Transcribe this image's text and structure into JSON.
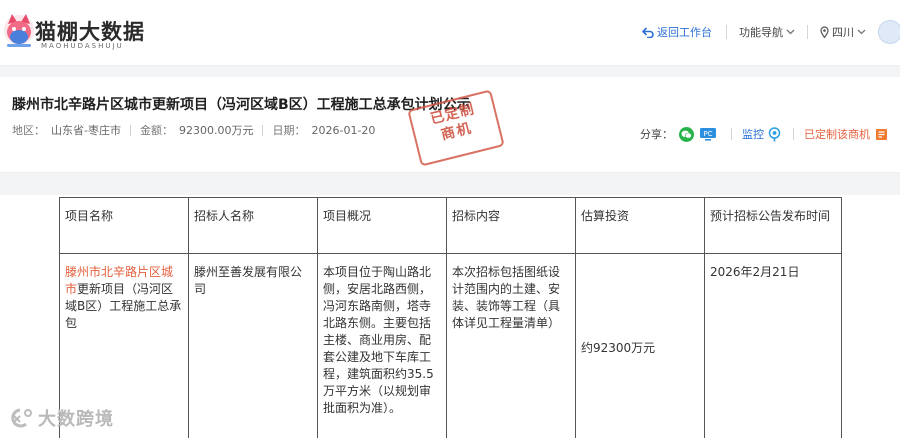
{
  "header": {
    "logo_title": "猫棚大数据",
    "logo_sub": "MAOHUDASHUJU",
    "return_label": "返回工作台",
    "nav_label": "功能导航",
    "region_label": "四川"
  },
  "project": {
    "title": "滕州市北辛路片区城市更新项目（冯河区域B区）工程施工总承包计划公示",
    "region_label": "地区：",
    "region_value": "山东省-枣庄市",
    "amount_label": "金额：",
    "amount_value": "92300.00万元",
    "date_label": "日期：",
    "date_value": "2026-01-20",
    "stamp_line1": "已定制",
    "stamp_line2": "商机",
    "share_label": "分享：",
    "pc_label": "PC",
    "monitor_label": "监控",
    "custom_label": "已定制该商机"
  },
  "table": {
    "headers": [
      "项目名称",
      "招标人名称",
      "项目概况",
      "招标内容",
      "估算投资",
      "预计招标公告发布时间"
    ],
    "row": {
      "name_link": "滕州市北辛路片区城市",
      "name_rest": "更新项目（冯河区域B区）工程施工总承包",
      "tenderer": "滕州至善发展有限公司",
      "overview": "本项目位于陶山路北侧，安居北路西侧，冯河东路南侧，塔寺北路东侧。主要包括主楼、商业用房、配套公建及地下车库工程，建筑面积约35.5万平方米（以规划审批面积为准）。",
      "content": "本次招标包括图纸设计范围内的土建、安装、装饰等工程（具体详见工程量清单）",
      "investment": "约92300万元",
      "publish_time": "2026年2月21日"
    }
  },
  "watermark": {
    "text": "大数跨境"
  },
  "colors": {
    "accent_blue": "#2c6fd6",
    "accent_orange": "#e4603e",
    "stamp_red": "#cc4b39",
    "wechat_green": "#27b34a"
  }
}
